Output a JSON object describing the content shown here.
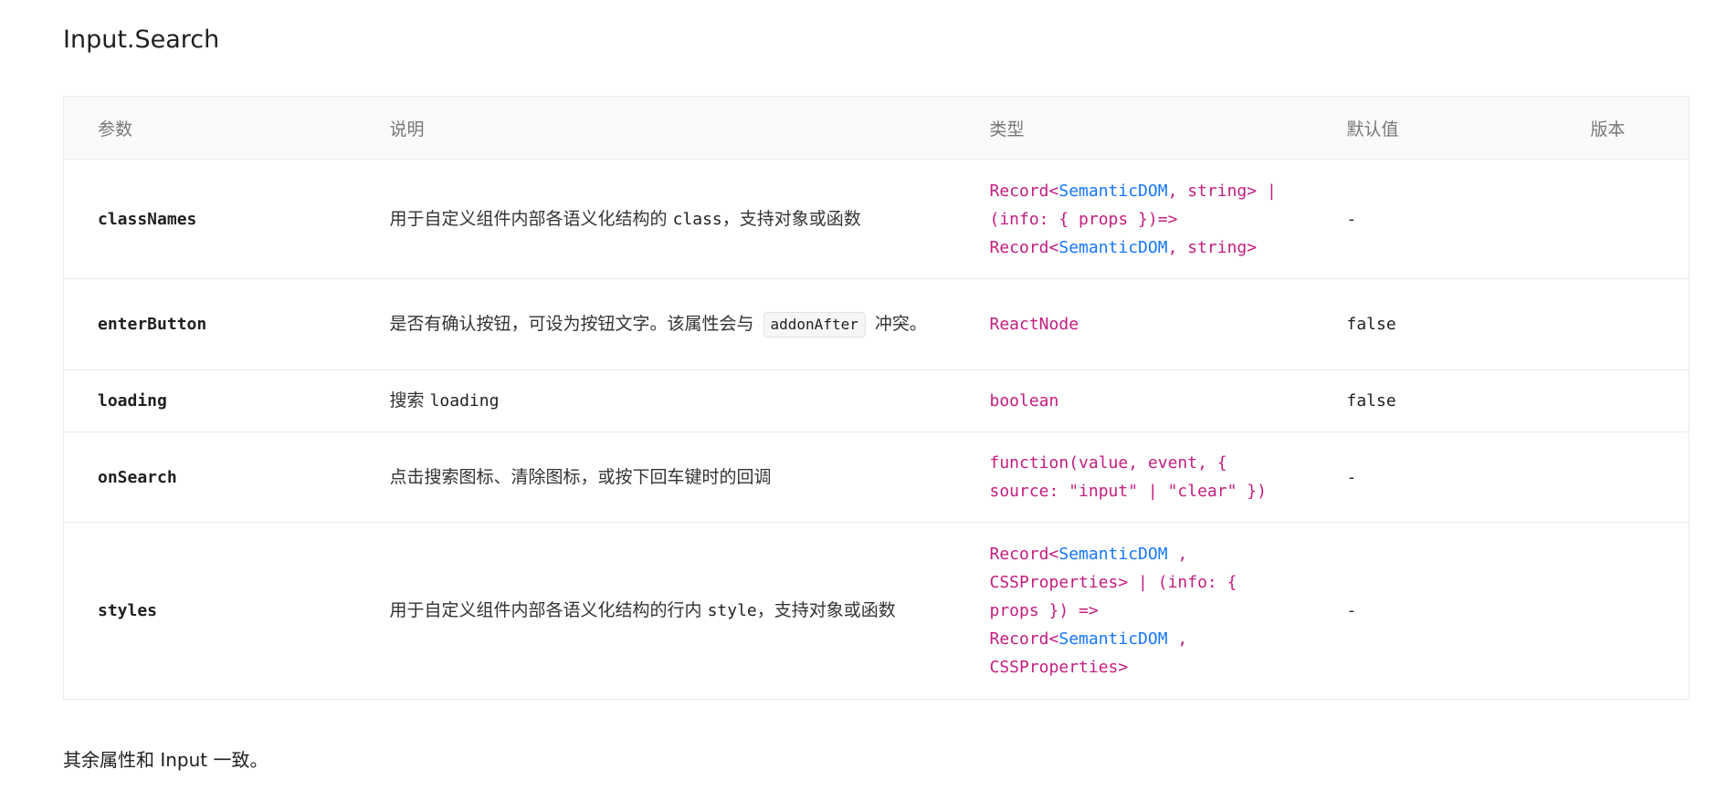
{
  "title": "Input.Search",
  "table": {
    "headers": [
      "参数",
      "说明",
      "类型",
      "默认值",
      "版本"
    ],
    "rows": [
      {
        "param": "classNames",
        "desc_before": "用于自定义组件内部各语义化结构的",
        "desc_code": "class",
        "desc_after": "，支持对象或函数",
        "type_lines": [
          [
            "Record<",
            "SemanticDOM",
            ", string> |"
          ],
          [
            "(info: { props })=>",
            "",
            ""
          ],
          [
            "Record<",
            "SemanticDOM",
            ", string>"
          ]
        ],
        "default": "-",
        "version": ""
      },
      {
        "param": "enterButton",
        "desc_before": "是否有确认按钮，可设为按钮文字。该属性会与",
        "desc_tag": "addonAfter",
        "desc_after": "冲突。",
        "type": "ReactNode",
        "default": "false",
        "version": ""
      },
      {
        "param": "loading",
        "desc_before": "搜索",
        "desc_code": "loading",
        "desc_after": "",
        "type": "boolean",
        "default": "false",
        "version": ""
      },
      {
        "param": "onSearch",
        "desc_before": "点击搜索图标、清除图标，或按下回车键时的回调",
        "type_line1": "function(value, event, {",
        "type_line2": "source: \"input\" | \"clear\" })",
        "default": "-",
        "version": ""
      },
      {
        "param": "styles",
        "desc_before": "用于自定义组件内部各语义化结构的行内",
        "desc_code": "style",
        "desc_after": "，支持对象或函数",
        "type_lines": [
          [
            "Record<",
            "SemanticDOM",
            " ,"
          ],
          [
            "CSSProperties> | (info: {",
            "",
            ""
          ],
          [
            "props }) =>",
            "",
            ""
          ],
          [
            "Record<",
            "SemanticDOM",
            " ,"
          ],
          [
            "CSSProperties>",
            "",
            ""
          ]
        ],
        "default": "-",
        "version": ""
      }
    ]
  },
  "footer": "其余属性和 Input 一致。"
}
